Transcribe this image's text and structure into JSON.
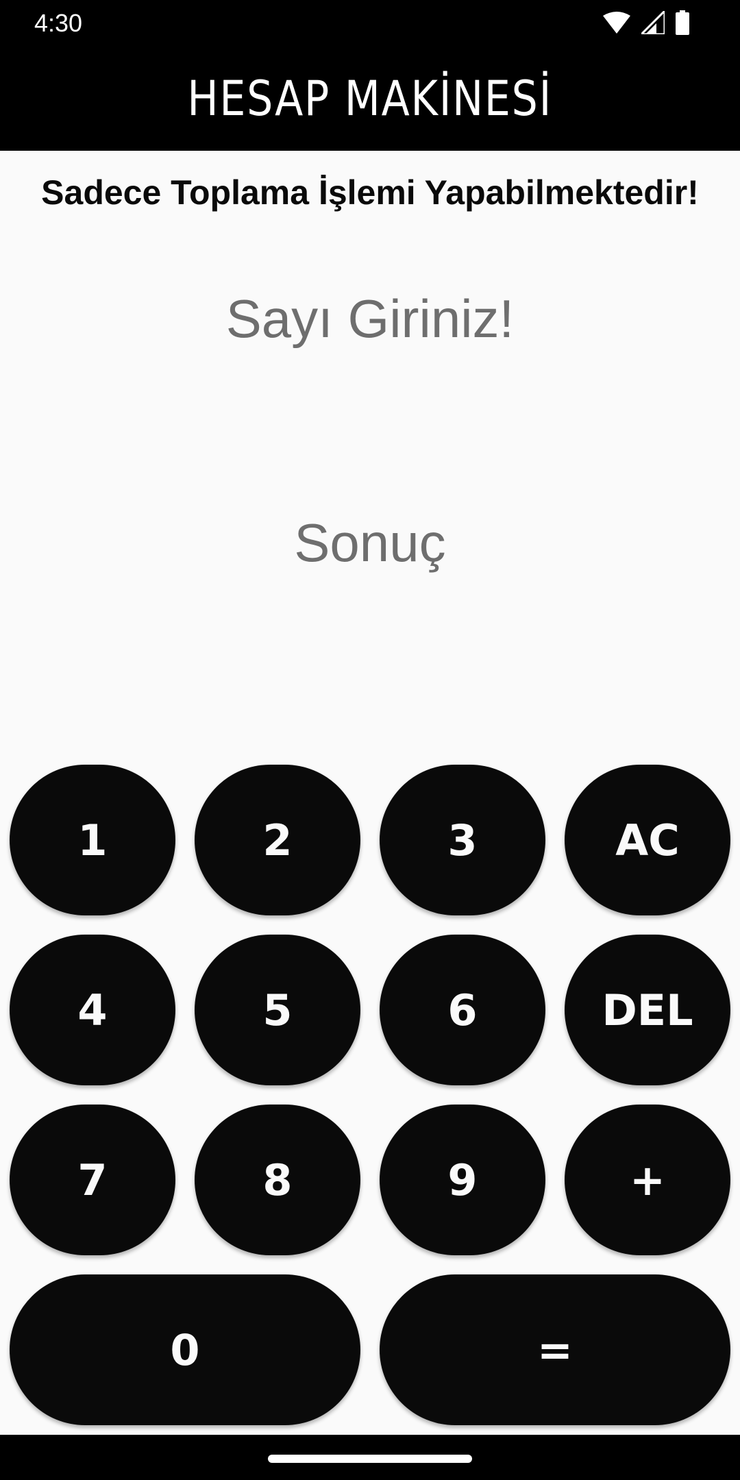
{
  "status_bar": {
    "time": "4:30",
    "icons": [
      "wifi-icon",
      "cell-signal-icon",
      "battery-icon"
    ]
  },
  "app_bar": {
    "title": "HESAP MAKİNESİ"
  },
  "subtitle": "Sadece Toplama İşlemi Yapabilmektedir!",
  "input": {
    "placeholder": "Sayı Giriniz!",
    "value": ""
  },
  "result": {
    "text": "Sonuç"
  },
  "keypad": {
    "key_1": "1",
    "key_2": "2",
    "key_3": "3",
    "key_ac": "AC",
    "key_4": "4",
    "key_5": "5",
    "key_6": "6",
    "key_del": "DEL",
    "key_7": "7",
    "key_8": "8",
    "key_9": "9",
    "key_plus": "+",
    "key_0": "0",
    "key_equals": "="
  },
  "colors": {
    "background": "#fafafa",
    "bar": "#000000",
    "button": "#0a0a0a",
    "button_text": "#fafafa",
    "hint_text": "#6e6e6e"
  }
}
